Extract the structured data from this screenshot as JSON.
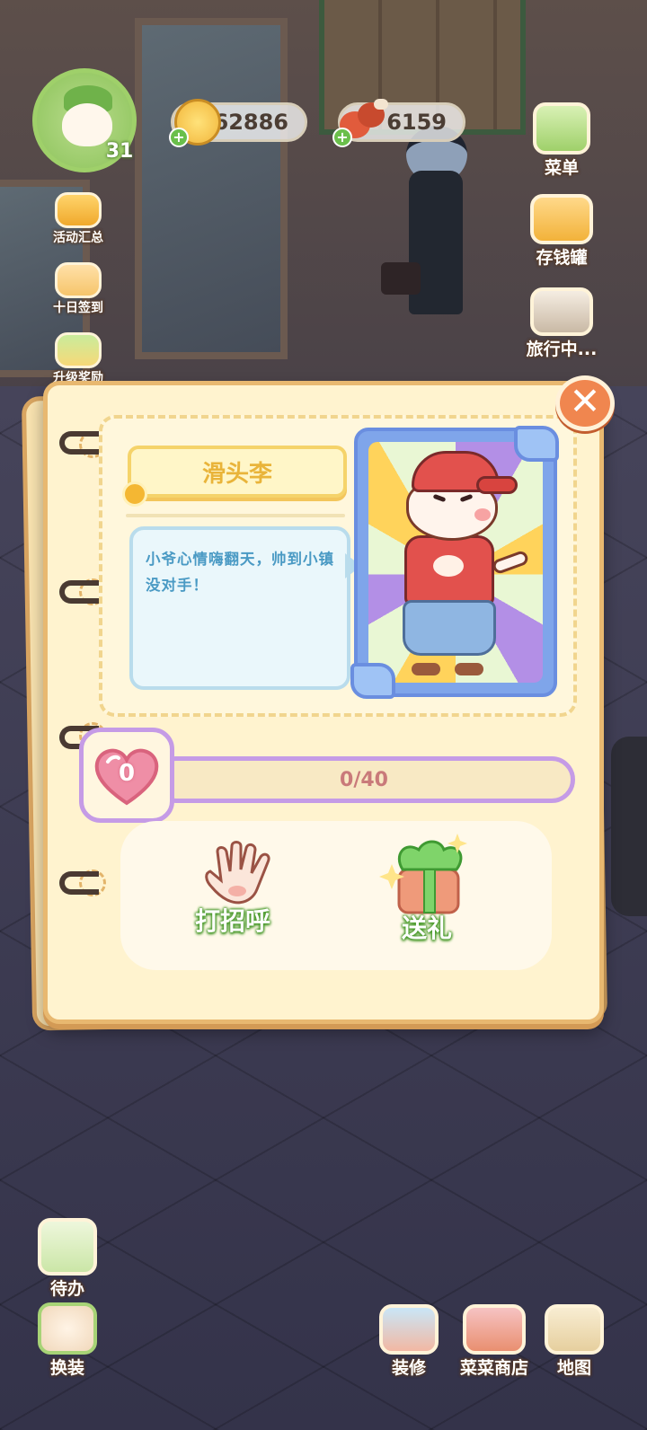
{
  "hud": {
    "level": "31",
    "coins": "62886",
    "meat": "6159"
  },
  "left_menu": [
    {
      "label": "活动汇总",
      "icon": "event-summary-icon"
    },
    {
      "label": "十日签到",
      "icon": "checkin-calendar-icon"
    },
    {
      "label": "升级奖励",
      "icon": "level-reward-icon"
    }
  ],
  "right_menu": [
    {
      "label": "菜单",
      "icon": "menu-book-icon"
    },
    {
      "label": "存钱罐",
      "icon": "piggy-bank-icon"
    },
    {
      "label": "旅行中...",
      "icon": "camera-icon"
    }
  ],
  "bottom_left": [
    {
      "label": "待办",
      "icon": "todo-list-icon"
    },
    {
      "label": "换装",
      "icon": "dress-up-icon"
    }
  ],
  "bottom_right": [
    {
      "label": "装修",
      "icon": "decorate-icon"
    },
    {
      "label": "菜菜商店",
      "icon": "shop-icon"
    },
    {
      "label": "地图",
      "icon": "map-icon"
    }
  ],
  "card": {
    "name": "滑头李",
    "quote": "小爷心情嗨翻天，帅到小镇没对手！",
    "affinity_level": "0",
    "affinity_progress_text": "0/40",
    "affinity_fraction": 0,
    "actions": [
      {
        "label": "打招呼",
        "icon": "waving-hand-icon"
      },
      {
        "label": "送礼",
        "icon": "gift-icon"
      }
    ]
  },
  "colors": {
    "card_bg": "#fff3cf",
    "accent_purple": "#c59be6",
    "action_green": "#4a9a2c",
    "close_orange": "#f0864f"
  }
}
